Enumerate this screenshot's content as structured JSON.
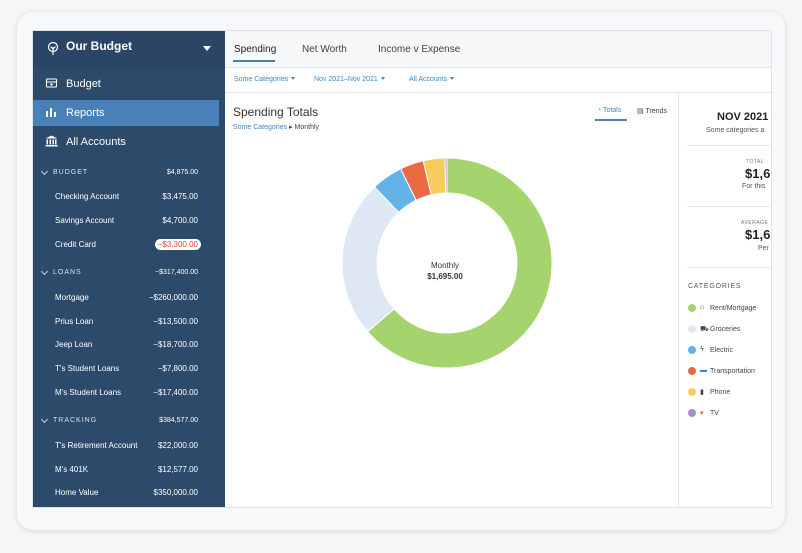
{
  "sidebar": {
    "budget_name": "Our Budget",
    "nav": [
      {
        "label": "Budget",
        "icon": "bank-building-icon"
      },
      {
        "label": "Reports",
        "icon": "bar-chart-icon"
      },
      {
        "label": "All Accounts",
        "icon": "institution-icon"
      }
    ],
    "groups": [
      {
        "name": "BUDGET",
        "total": "$4,875.00",
        "accounts": [
          {
            "name": "Checking Account",
            "value": "$3,475.00"
          },
          {
            "name": "Savings Account",
            "value": "$4,700.00"
          },
          {
            "name": "Credit Card",
            "value": "−$3,300.00",
            "negative": true
          }
        ]
      },
      {
        "name": "LOANS",
        "total": "−$317,400.00",
        "accounts": [
          {
            "name": "Mortgage",
            "value": "−$260,000.00"
          },
          {
            "name": "Prius Loan",
            "value": "−$13,500.00"
          },
          {
            "name": "Jeep Loan",
            "value": "−$18,700.00"
          },
          {
            "name": "T's Student Loans",
            "value": "−$7,800.00"
          },
          {
            "name": "M's Student Loans",
            "value": "−$17,400.00"
          }
        ]
      },
      {
        "name": "TRACKING",
        "total": "$384,577.00",
        "accounts": [
          {
            "name": "T's Retirement Account",
            "value": "$22,000.00"
          },
          {
            "name": "M's 401K",
            "value": "$12,577.00"
          },
          {
            "name": "Home Value",
            "value": "$350,000.00"
          }
        ]
      }
    ]
  },
  "tabs": [
    "Spending",
    "Net Worth",
    "Income v Expense"
  ],
  "filters": [
    "Some Categories",
    "Nov 2021–Nov 2021",
    "All Accounts"
  ],
  "report": {
    "title": "Spending Totals",
    "breadcrumb_link": "Some Categories",
    "breadcrumb_current": "Monthly",
    "toggle_totals": "Totals",
    "toggle_trends": "Trends",
    "center_label": "Monthly",
    "center_value": "$1,695.00"
  },
  "right_panel": {
    "date": "NOV 2021",
    "subtitle": "Some categories a",
    "total_label": "TOTAL",
    "total_value": "$1,6",
    "total_note": "For this",
    "average_label": "AVERAGE",
    "average_value": "$1,6",
    "average_note": "Per",
    "categories_heading": "CATEGORIES",
    "categories": [
      {
        "name": "Rent/Mortgage",
        "color": "#a5d46e",
        "icon": "house-icon"
      },
      {
        "name": "Groceries",
        "color": "#dde8f4",
        "icon": "cart-icon"
      },
      {
        "name": "Electric",
        "color": "#63b3e8",
        "icon": "plug-icon"
      },
      {
        "name": "Transportation",
        "color": "#ea6a44",
        "icon": "car-icon"
      },
      {
        "name": "Phone",
        "color": "#f8cc5c",
        "icon": "phone-icon"
      },
      {
        "name": "TV",
        "color": "#a98bc9",
        "icon": "popcorn-icon"
      }
    ]
  },
  "chart_data": {
    "type": "pie",
    "categories": [
      "Rent/Mortgage",
      "Groceries",
      "Electric",
      "Transportation",
      "Phone",
      "TV"
    ],
    "values": [
      1050,
      400,
      80,
      60,
      55,
      5
    ],
    "colors": [
      "#a5d46e",
      "#dde8f4",
      "#63b3e8",
      "#ea6a44",
      "#f8cc5c",
      "#a98bc9"
    ],
    "title": "Spending Totals"
  }
}
